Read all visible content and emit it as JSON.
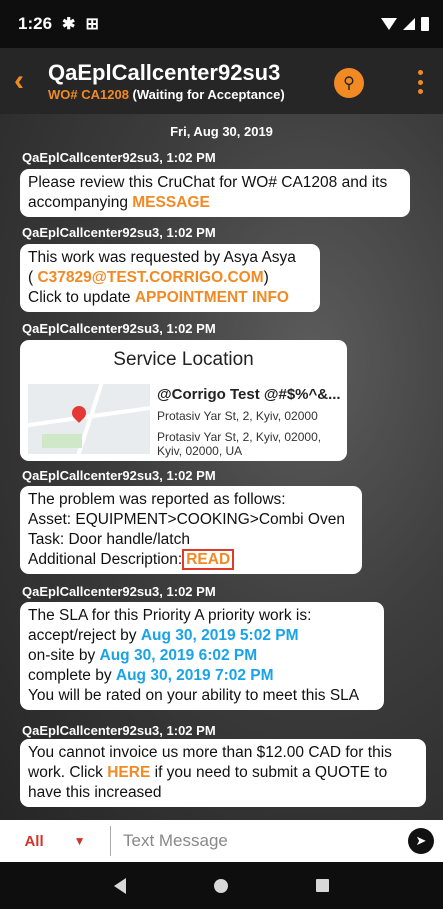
{
  "status": {
    "time": "1:26",
    "gear_icon": "gear-icon",
    "app_icon": "app-icon"
  },
  "header": {
    "title": "QaEplCallcenter92su3",
    "wo_label": "WO# CA1208",
    "status": "(Waiting for Acceptance)"
  },
  "chat": {
    "date": "Fri, Aug 30, 2019",
    "sender_time": "QaEplCallcenter92su3, 1:02 PM",
    "m1": {
      "text": "Please review this CruChat for WO# CA1208 and its accompanying ",
      "link": "MESSAGE"
    },
    "m2": {
      "line1": "This work was requested by Asya Asya",
      "open": "( ",
      "email": "C37829@TEST.CORRIGO.COM",
      "close": ")",
      "line3": "Click to update ",
      "link": "APPOINTMENT INFO"
    },
    "m3": {
      "title": "Service Location",
      "name": "@Corrigo Test @#$%^&...",
      "addr1": "Protasiv Yar St, 2, Kyiv, 02000",
      "addr2": "Protasiv Yar St, 2, Kyiv, 02000, Kyiv,  02000, UA"
    },
    "m4": {
      "line1": "The problem was reported as follows:",
      "asset_label": "Asset: ",
      "asset": "EQUIPMENT>COOKING>Combi Oven",
      "task_label": "Task: ",
      "task": "Door handle/latch",
      "desc_label": "Additional Description:",
      "read": "READ"
    },
    "m5": {
      "line1": "The SLA for this Priority A priority work is:",
      "accept": "accept/reject by ",
      "accept_date": "Aug 30, 2019 5:02 PM",
      "onsite": "on-site by ",
      "onsite_date": "Aug 30, 2019 6:02 PM",
      "complete": "complete by ",
      "complete_date": "Aug 30, 2019 7:02 PM",
      "line5": "You will be rated on your ability to meet this SLA"
    },
    "m6": {
      "text1": "You cannot invoice us more than $12.00 CAD for this work. Click ",
      "link": "HERE",
      "text2": " if you need to submit a QUOTE to have this increased"
    }
  },
  "input": {
    "filter": "All",
    "placeholder": "Text Message"
  },
  "colors": {
    "accent": "#f28a24",
    "link_blue": "#1aa3e8",
    "alert_red": "#d0352a"
  }
}
